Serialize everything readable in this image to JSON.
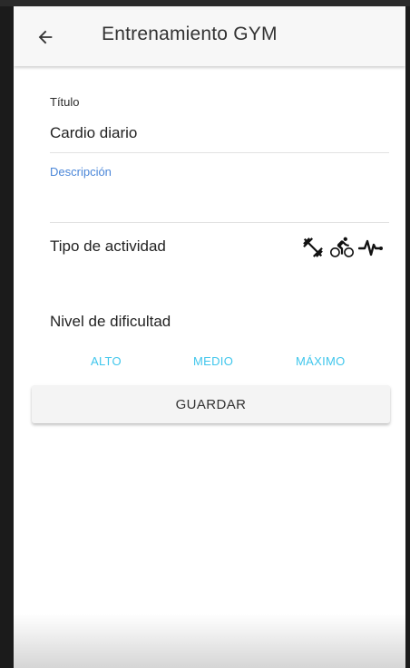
{
  "appbar": {
    "title": "Entrenamiento GYM",
    "back_icon": "arrow-left-icon"
  },
  "form": {
    "title_label": "Título",
    "title_value": "Cardio diario",
    "description_label": "Descripción",
    "description_value": "",
    "activity_label": "Tipo de actividad",
    "activity_icons": [
      "dumbbell-icon",
      "bicycle-icon",
      "heartbeat-icon"
    ],
    "difficulty_label": "Nivel de dificultad",
    "difficulty_options": [
      "ALTO",
      "MEDIO",
      "MÁXIMO"
    ],
    "save_label": "GUARDAR"
  },
  "colors": {
    "accent_label": "#4a86d8",
    "option_text": "#3fc6ec",
    "appbar_bg": "#f7f7f7"
  }
}
